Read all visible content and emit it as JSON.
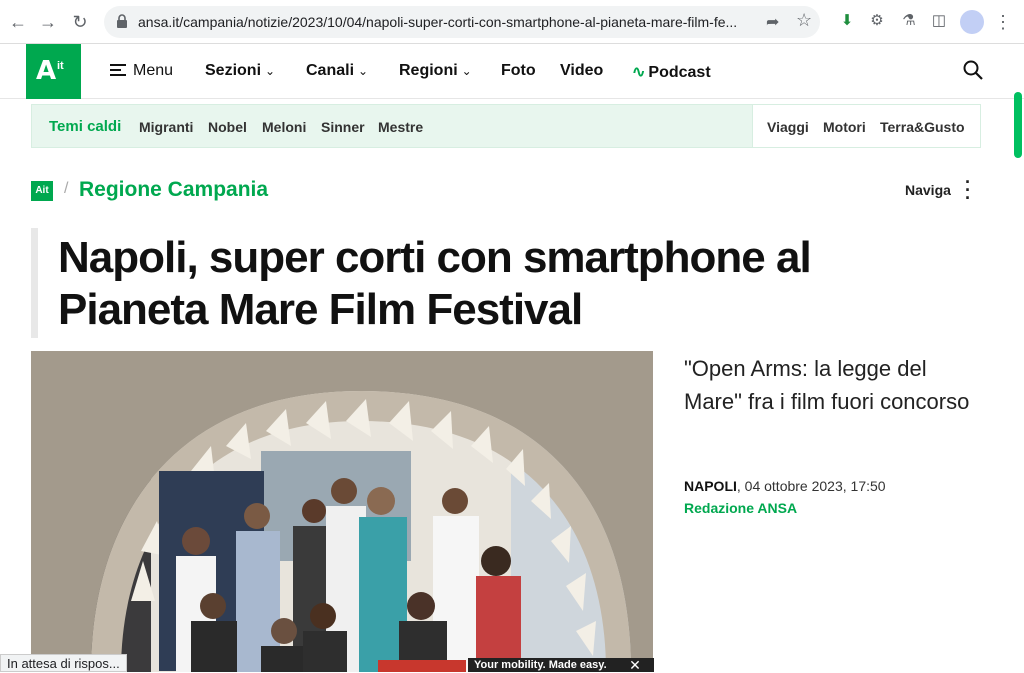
{
  "browser": {
    "url": "ansa.it/campania/notizie/2023/10/04/napoli-super-corti-con-smartphone-al-pianeta-mare-film-fe...",
    "status_text": "In attesa di rispos..."
  },
  "header": {
    "logo_text": "A",
    "logo_small": "it",
    "menu_label": "Menu",
    "nav": [
      {
        "label": "Sezioni",
        "dropdown": true
      },
      {
        "label": "Canali",
        "dropdown": true
      },
      {
        "label": "Regioni",
        "dropdown": true
      },
      {
        "label": "Foto",
        "dropdown": false
      },
      {
        "label": "Video",
        "dropdown": false
      },
      {
        "label": "Podcast",
        "dropdown": false
      }
    ]
  },
  "hot_topics": {
    "label": "Temi caldi",
    "items": [
      "Migranti",
      "Nobel",
      "Meloni",
      "Sinner",
      "Mestre"
    ],
    "right_items": [
      "Viaggi",
      "Motori",
      "Terra&Gusto"
    ]
  },
  "breadcrumb": {
    "logo_text": "Ait",
    "region": "Regione Campania",
    "naviga": "Naviga"
  },
  "article": {
    "title": "Napoli, super corti con smartphone al Pianeta Mare Film Festival",
    "subtitle": "\"Open Arms: la legge del Mare\" fra i film fuori concorso",
    "place": "NAPOLI",
    "date": ", 04 ottobre 2023, 17:50",
    "author": "Redazione ANSA"
  },
  "ad": {
    "text": "Your mobility. Made easy."
  },
  "colors": {
    "brand_green": "#00a84f"
  }
}
